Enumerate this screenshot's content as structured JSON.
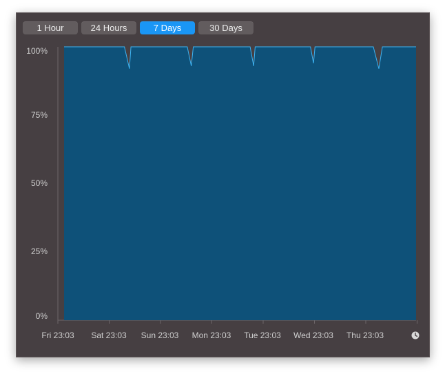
{
  "time_range": {
    "options": [
      "1 Hour",
      "24 Hours",
      "7 Days",
      "30 Days"
    ],
    "selected": "7 Days"
  },
  "colors": {
    "window_bg": "#463f42",
    "button_bg": "#625c5e",
    "button_selected_bg": "#1a96f5",
    "area_fill": "#0e5179",
    "line": "#3cb4f4",
    "axis": "#6e676a"
  },
  "icons": {
    "time_icon": "clock-icon"
  },
  "chart_data": {
    "type": "area",
    "y_tick_labels": [
      "100%",
      "75%",
      "50%",
      "25%",
      "0%"
    ],
    "x_tick_labels": [
      "Fri 23:03",
      "Sat 23:03",
      "Sun 23:03",
      "Mon 23:03",
      "Tue 23:03",
      "Wed 23:03",
      "Thu 23:03"
    ],
    "ylim": [
      0,
      100
    ],
    "xlim": [
      0,
      7
    ],
    "grid": false,
    "series": [
      {
        "points": [
          [
            0,
            100
          ],
          [
            1.2,
            100
          ],
          [
            1.3,
            92
          ],
          [
            1.33,
            100
          ],
          [
            2.45,
            100
          ],
          [
            2.53,
            93
          ],
          [
            2.57,
            100
          ],
          [
            3.7,
            100
          ],
          [
            3.77,
            93
          ],
          [
            3.8,
            100
          ],
          [
            4.9,
            100
          ],
          [
            4.96,
            94
          ],
          [
            4.99,
            100
          ],
          [
            6.15,
            100
          ],
          [
            6.26,
            92
          ],
          [
            6.33,
            100
          ],
          [
            7,
            100
          ]
        ]
      }
    ]
  }
}
